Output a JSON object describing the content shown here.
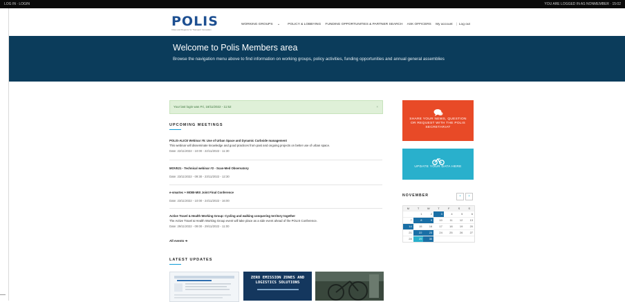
{
  "topbar": {
    "left_text": "LOG IN · LOGIN",
    "right_text": "YOU ARE LOGGED IN AS NONMEMBER · 15:02"
  },
  "header": {
    "logo": "POLIS",
    "tagline": "Cities and Regions for Transport Innovation",
    "nav": [
      "WORKING GROUPS",
      "POLICY & LOBBYING",
      "FUNDING OPPORTUNITIES & PARTNER SEARCH",
      "ASK OFFICERS"
    ],
    "account": "My account",
    "logout": "Log out"
  },
  "hero": {
    "title": "Welcome to Polis Members area",
    "subtitle": "Browse the navigation menu above to find information on working groups, policy activities, funding opportunities and annual general assemblies"
  },
  "login_notice": "Your last login was Fri, 18/11/2022 - 11:52",
  "upcoming": {
    "title": "UPCOMING MEETINGS",
    "meetings": [
      {
        "title": "POLIS-ALICE Webinar #5: Use of Urban Space and Dynamic Curbside management",
        "desc": "This webinar will disseminate knowledge and good practices from past and ongoing projects on better use of urban space.",
        "date": "Date: 22/11/2022 - 10:00 - 22/11/2022 - 11:30"
      },
      {
        "title": "MOVE21 - Technical webinar #2 - Scan-Med Observatory",
        "desc": "",
        "date": "Date: 23/11/2022 - 09:30 - 23/11/2022 - 12:30"
      },
      {
        "title": "e-smartec + MOBI-MIX Joint Final Conference",
        "desc": "",
        "date": "Date: 23/11/2022 - 10:00 - 24/11/2022 - 16:00"
      },
      {
        "title": "Active Travel & Health Working Group: Cycling and walking conquering territory together",
        "desc": "The Active Travel & Health Working Group event will take place as a side event ahead of the POLIS Conference.",
        "date": "Date: 29/11/2022 - 09:00 - 29/11/2022 - 11:00"
      }
    ],
    "all_events": "All events ➔"
  },
  "latest": {
    "title": "LATEST UPDATES",
    "thumb2_text": "ZERO EMISSION ZONES AND LOGISTICS SOLUTIONS"
  },
  "share_box": {
    "text": "SHARE YOUR NEWS, QUESTION OR REQUEST WITH THE POLIS SECRETARIAT",
    "icon": "chat-bubbles-icon",
    "color": "#e84a27"
  },
  "update_box": {
    "text": "UPDATE YOUR DATA HERE",
    "icon": "bicycle-icon",
    "color": "#29b0cc"
  },
  "calendar": {
    "month": "NOVEMBER",
    "weekdays": [
      "M",
      "T",
      "W",
      "T",
      "F",
      "S",
      "S"
    ],
    "weeks": [
      [
        "",
        "1",
        "2",
        "3",
        "4",
        "5",
        "6"
      ],
      [
        "7",
        "8",
        "9",
        "10",
        "11",
        "12",
        "13"
      ],
      [
        "14",
        "15",
        "16",
        "17",
        "18",
        "19",
        "20"
      ],
      [
        "21",
        "22",
        "23",
        "24",
        "25",
        "26",
        "27"
      ],
      [
        "28",
        "29",
        "30",
        "",
        "",
        "",
        ""
      ]
    ],
    "event_days": [
      "3",
      "8",
      "9",
      "14",
      "22",
      "23",
      "29",
      "30"
    ],
    "today": "29"
  }
}
